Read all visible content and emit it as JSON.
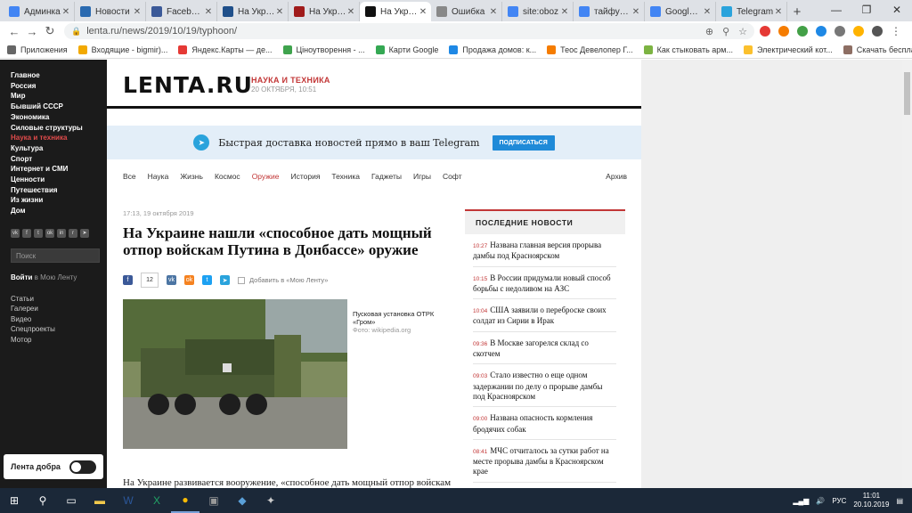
{
  "browser": {
    "tabs": [
      {
        "label": "Админка",
        "color": "#4285f4"
      },
      {
        "label": "Новости",
        "color": "#2a6ab0"
      },
      {
        "label": "Facebook",
        "color": "#3b5998"
      },
      {
        "label": "На Украине",
        "color": "#1f4f8a"
      },
      {
        "label": "На Украине",
        "color": "#a01b1b"
      },
      {
        "label": "На Украине",
        "color": "#111111"
      },
      {
        "label": "Ошибка",
        "color": "#888888"
      },
      {
        "label": "site:oboz",
        "color": "#4285f4"
      },
      {
        "label": "тайфун-1",
        "color": "#4285f4"
      },
      {
        "label": "Google П",
        "color": "#4285f4"
      },
      {
        "label": "Telegram",
        "color": "#2aa3dc"
      }
    ],
    "active_tab": 5,
    "url": "lenta.ru/news/2019/10/19/typhoon/",
    "bookmarks": [
      {
        "label": "Приложения",
        "color": "#666666"
      },
      {
        "label": "Входящие - bigmir)...",
        "color": "#f2a900"
      },
      {
        "label": "Яндекс.Карты — де...",
        "color": "#e53935"
      },
      {
        "label": "Ціноутворення - ...",
        "color": "#3fa34d"
      },
      {
        "label": "Карти Google",
        "color": "#34a853"
      },
      {
        "label": "Продажа домов: к...",
        "color": "#1e88e5"
      },
      {
        "label": "Теос Девелопер Г...",
        "color": "#f57c00"
      },
      {
        "label": "Как стыковать арм...",
        "color": "#7cb342"
      },
      {
        "label": "Электрический кот...",
        "color": "#fbc02d"
      },
      {
        "label": "Скачать бесплатно...",
        "color": "#8d6e63"
      }
    ]
  },
  "sidebar": {
    "rubrics": [
      "Главное",
      "Россия",
      "Мир",
      "Бывший СССР",
      "Экономика",
      "Силовые структуры",
      "Наука и техника",
      "Культура",
      "Спорт",
      "Интернет и СМИ",
      "Ценности",
      "Путешествия",
      "Из жизни",
      "Дом"
    ],
    "active_rubric": "Наука и техника",
    "search_placeholder": "Поиск",
    "login_bold": "Войти",
    "login_rest": "в Мою Ленту",
    "secondary": [
      "Статьи",
      "Галереи",
      "Видео",
      "Спецпроекты",
      "Мотор"
    ],
    "theme_label": "Лента добра"
  },
  "header": {
    "logo": "LENTA.RU",
    "section": "НАУКА И ТЕХНИКА",
    "date": "20 ОКТЯБРЯ, 10:51"
  },
  "banner": {
    "text": "Быстрая доставка новостей прямо в ваш Telegram",
    "button": "ПОДПИСАТЬСЯ"
  },
  "subnav": {
    "items": [
      "Все",
      "Наука",
      "Жизнь",
      "Космос",
      "Оружие",
      "История",
      "Техника",
      "Гаджеты",
      "Игры",
      "Софт"
    ],
    "active": "Оружие",
    "archive": "Архив"
  },
  "article": {
    "date": "17:13, 19 октября 2019",
    "title": "На Украине нашли «способное дать мощный отпор войскам Путина в Донбассе» оружие",
    "share_count": "12",
    "add_to_feed": "Добавить в «Мою Ленту»",
    "caption": "Пусковая установка ОТРК «Гром»",
    "photo_source": "Фото: wikipedia.org",
    "lead": "На Украине развивается вооружение, «способное дать мощный отпор войскам"
  },
  "latest": {
    "heading": "ПОСЛЕДНИЕ НОВОСТИ",
    "items": [
      {
        "time": "10:27",
        "text": "Названа главная версия прорыва дамбы под Красноярском"
      },
      {
        "time": "10:15",
        "text": "В России придумали новый способ борьбы с недоливом на АЗС"
      },
      {
        "time": "10:04",
        "text": "США заявили о переброске своих солдат из Сирии в Ирак"
      },
      {
        "time": "09:36",
        "text": "В Москве загорелся склад со скотчем"
      },
      {
        "time": "09:03",
        "text": "Стало известно о еще одном задержании по делу о прорыве дамбы под Красноярском"
      },
      {
        "time": "09:00",
        "text": "Названа опасность кормления бродячих собак"
      },
      {
        "time": "08:41",
        "text": "МЧС отчиталось за сутки работ на месте прорыва дамбы в Красноярском крае"
      }
    ]
  },
  "taskbar": {
    "lang": "РУС",
    "time": "11:01",
    "date": "20.10.2019"
  }
}
